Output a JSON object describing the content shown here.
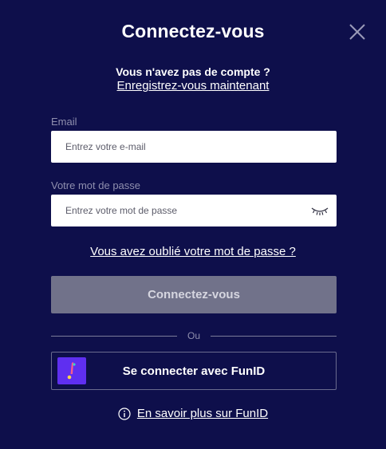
{
  "modal": {
    "title": "Connectez-vous",
    "close_icon": "close-icon"
  },
  "signup": {
    "question": "Vous n'avez pas de compte ?",
    "link": "Enregistrez-vous maintenant"
  },
  "email": {
    "label": "Email",
    "placeholder": "Entrez votre e-mail",
    "value": ""
  },
  "password": {
    "label": "Votre mot de passe",
    "placeholder": "Entrez votre mot de passe",
    "value": "",
    "toggle_icon": "eye-closed-icon"
  },
  "forgot_password": "Vous avez oublié votre mot de passe ?",
  "submit_label": "Connectez-vous",
  "divider_label": "Ou",
  "funid": {
    "button_label": "Se connecter avec FunID",
    "logo_icon": "funid-logo-icon",
    "learn_more": "En savoir plus sur FunID",
    "info_icon": "info-icon"
  },
  "colors": {
    "background": "#0e0f4b",
    "submit_disabled": "#71728a",
    "funid_logo": "#5f2ff0"
  }
}
